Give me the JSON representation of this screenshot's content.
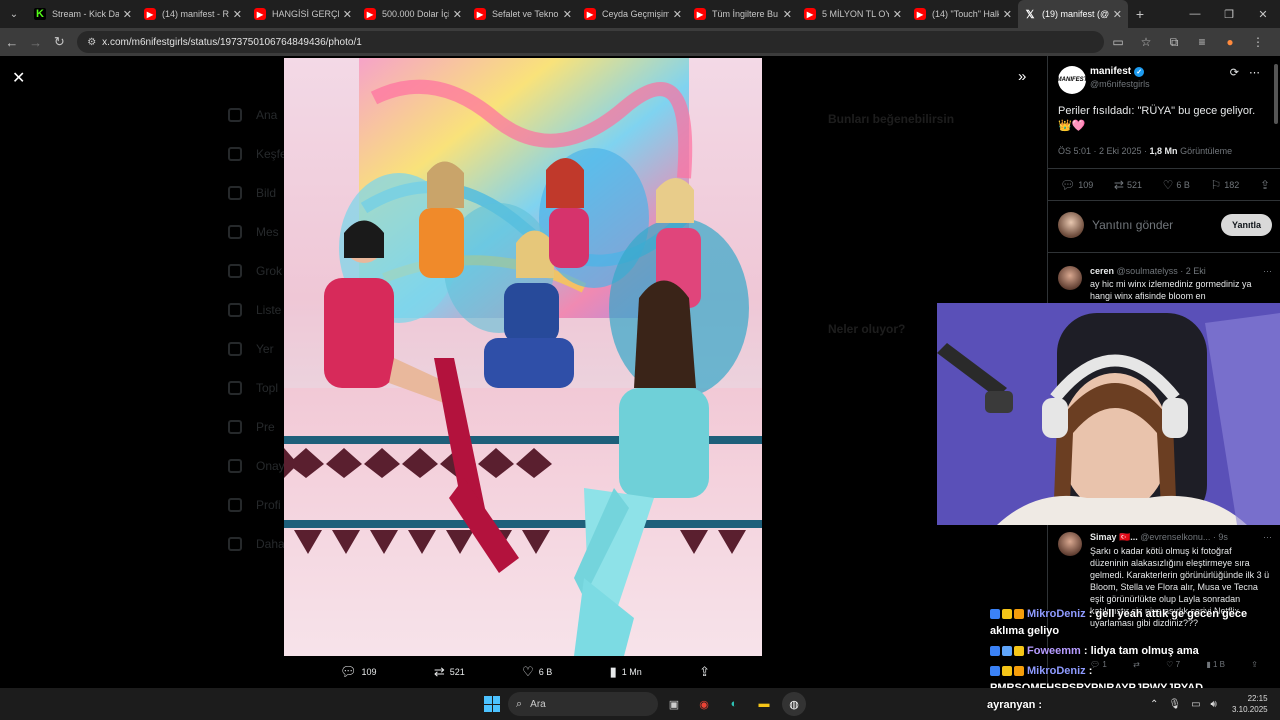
{
  "tabs": [
    {
      "label": "Stream - Kick Das",
      "icon": "kick",
      "active": false
    },
    {
      "label": "(14) manifest - RÜ",
      "icon": "youtube",
      "active": false
    },
    {
      "label": "HANGİSİ GERÇEK",
      "icon": "youtube",
      "active": false
    },
    {
      "label": "500.000 Dolar İçin",
      "icon": "youtube",
      "active": false
    },
    {
      "label": "Sefalet ve Teknolo",
      "icon": "youtube",
      "active": false
    },
    {
      "label": "Ceyda Geçmişim",
      "icon": "youtube",
      "active": false
    },
    {
      "label": "Tüm İngiltere Bu",
      "icon": "youtube",
      "active": false
    },
    {
      "label": "5 MİLYON TL OYU",
      "icon": "youtube",
      "active": false
    },
    {
      "label": "(14) \"Touch\" Halk",
      "icon": "youtube",
      "active": false
    },
    {
      "label": "(19) manifest (@m",
      "icon": "x",
      "active": true
    }
  ],
  "url": "x.com/m6nifestgirls/status/1973750106764849436/photo/1",
  "background": {
    "nav_items": [
      "Ana",
      "Keşfe",
      "Bild",
      "Mes",
      "Grok",
      "Liste",
      "Yer",
      "Topl",
      "Pre",
      "Onay",
      "Profi",
      "Daha"
    ],
    "right_title_1": "Bunları beğenebilirsin",
    "right_title_2": "Neler oluyor?"
  },
  "tweet": {
    "author_name": "manifest",
    "author_handle": "@m6nifestgirls",
    "avatar_text": "MANIFEST",
    "text": "Periler fısıldadı: \"RÜYA\" bu gece geliyor.",
    "emojis": "👑🩷",
    "time": "ÖS 5:01 · 2 Eki 2025 · ",
    "views_value": "1,8 Mn",
    "views_label": " Görüntüleme",
    "replies": "109",
    "reposts": "521",
    "likes": "6 B",
    "bookmarks": "182",
    "reply_placeholder": "Yanıtını gönder",
    "reply_button": "Yanıtla"
  },
  "photo_actions": {
    "replies": "109",
    "reposts": "521",
    "likes": "6 B",
    "views": "1 Mn"
  },
  "comments": [
    {
      "name": "ceren",
      "handle": "@soulmatelyss · 2 Eki",
      "text": "ay hic mi winx izlemediniz gormediniz ya hangi winx afisinde bloom en"
    },
    {
      "name": "Simay 🇹🇷...",
      "handle": "@evrenselkonu... · 9s",
      "text": "Şarkı o kadar kötü olmuş ki fotoğraf düzeninin alakasızlığını eleştirmeye sıra gelmedi. Karakterlerin görünürlüğünde ilk 3 ü Bloom, Stella ve Flora alır, Musa ve Tecna eşit görünürlükte olup Layla sonradan katılmıştır siz niye asırlık seriyi Netflix uyarlaması gibi dizdiniz???"
    }
  ],
  "comment_stats": {
    "replies": "1",
    "reposts": "",
    "likes": "7",
    "views": "1 B"
  },
  "chat": [
    {
      "user": "MikroDeniz",
      "message": ": gell yeah attık ge gecen gece aklıma geliyo"
    },
    {
      "user": "Foweemm",
      "message": ": lidya tam olmuş ama"
    },
    {
      "user": "MikroDeniz",
      "message": ": PMRSOMFHSPSRYPNRAYPJRWYJPYAD"
    },
    {
      "user": "ayranyan",
      "message": ":"
    }
  ],
  "taskbar": {
    "search_label": "Ara",
    "time": "22:15",
    "date": "3.10.2025"
  },
  "colors": {
    "x_blue": "#1d9bf0",
    "youtube_red": "#ff0000",
    "kick_green": "#53fc18",
    "chat_user": "#8f9bff"
  }
}
